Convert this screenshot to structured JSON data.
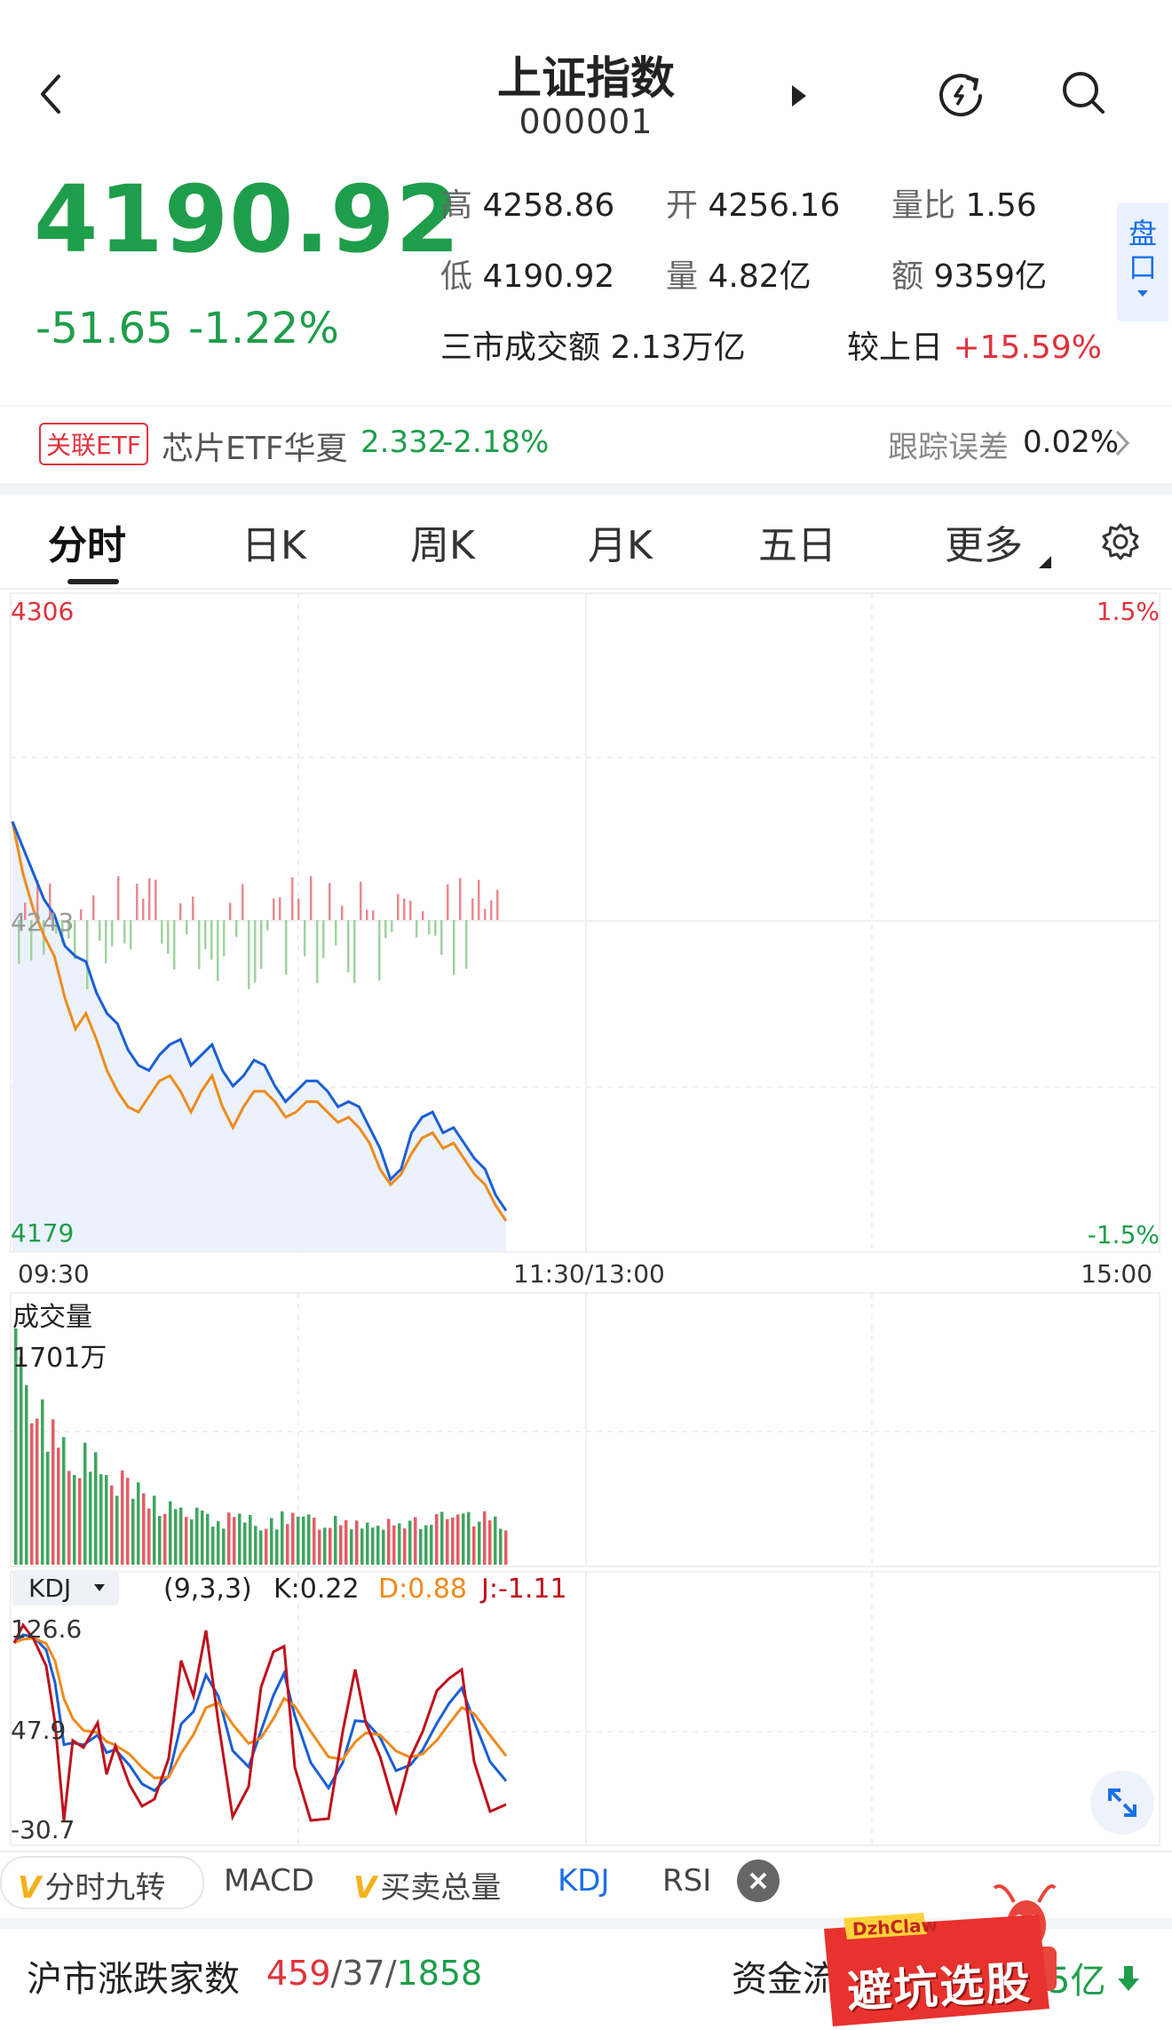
{
  "header": {
    "title": "上证指数",
    "code": "000001"
  },
  "quote": {
    "price": "4190.92",
    "change": "-51.65",
    "change_pct": "-1.22%",
    "high_label": "高",
    "high": "4258.86",
    "open_label": "开",
    "open": "4256.16",
    "ratio_label": "量比",
    "ratio": "1.56",
    "low_label": "低",
    "low": "4190.92",
    "volume_label": "量",
    "volume": "4.82亿",
    "amount_label": "额",
    "amount": "9359亿",
    "market_amount_label": "三市成交额",
    "market_amount": "2.13万亿",
    "vs_prev_label": "较上日",
    "vs_prev": "+15.59%",
    "side_button": "盘口"
  },
  "etf": {
    "tag": "关联ETF",
    "name": "芯片ETF华夏",
    "price": "2.332",
    "change_pct": "-2.18%",
    "track_label": "跟踪误差",
    "track_value": "0.02%"
  },
  "tabs": [
    "分时",
    "日K",
    "周K",
    "月K",
    "五日",
    "更多"
  ],
  "active_tab": 0,
  "chart": {
    "y_top": "4306",
    "y_mid": "4243",
    "y_bottom": "4179",
    "pct_top": "1.5%",
    "pct_bottom": "-1.5%",
    "t_start": "09:30",
    "t_mid": "11:30/13:00",
    "t_end": "15:00",
    "volume_title": "成交量",
    "volume_max": "1701万"
  },
  "kdj": {
    "selector": "KDJ",
    "params": "(9,3,3)",
    "k": "K:0.22",
    "d": "D:0.88",
    "j": "J:-1.11",
    "y_top": "126.6",
    "y_mid": "47.9",
    "y_bottom": "-30.7"
  },
  "indicator_tabs": [
    "分时九转",
    "MACD",
    "买卖总量",
    "KDJ",
    "RSI"
  ],
  "indicator_active": 3,
  "footer": {
    "breadth_label": "沪市涨跌家数",
    "up": "459",
    "flat": "37",
    "down": "1858",
    "fund_label": "资金流",
    "fund_value": "5亿",
    "promo_brand": "DzhClaw",
    "promo_text": "避坑选股"
  },
  "colors": {
    "up": "#e0323c",
    "down": "#1e9e4a",
    "price_line": "#1a5fd6",
    "avg_line": "#f08a1c",
    "accent": "#1a6fe6"
  },
  "chart_data": {
    "type": "line",
    "x_range": [
      "09:30",
      "15:00"
    ],
    "y_range": [
      4179,
      4306
    ],
    "prev_close": 4243,
    "price": [
      4262,
      4257,
      4252,
      4247,
      4244,
      4238,
      4236,
      4235,
      4229,
      4225,
      4223,
      4218,
      4215,
      4214,
      4217,
      4219,
      4220,
      4215,
      4217,
      4219,
      4214,
      4211,
      4213,
      4216,
      4215,
      4211,
      4208,
      4210,
      4212,
      4212,
      4210,
      4207,
      4208,
      4207,
      4203,
      4199,
      4193,
      4195,
      4202,
      4205,
      4206,
      4202,
      4203,
      4200,
      4197,
      4195,
      4190,
      4187
    ],
    "avg": [
      4262,
      4252,
      4245,
      4240,
      4236,
      4228,
      4222,
      4225,
      4220,
      4214,
      4210,
      4207,
      4206,
      4209,
      4212,
      4213,
      4210,
      4206,
      4210,
      4213,
      4207,
      4203,
      4207,
      4210,
      4210,
      4208,
      4205,
      4206,
      4208,
      4208,
      4206,
      4204,
      4205,
      4203,
      4200,
      4195,
      4192,
      4194,
      4198,
      4201,
      4202,
      4199,
      4200,
      4197,
      4194,
      4192,
      4188,
      4185
    ],
    "volume_max_label": "1701万",
    "kdj_range": [
      -30.7,
      126.6
    ]
  }
}
